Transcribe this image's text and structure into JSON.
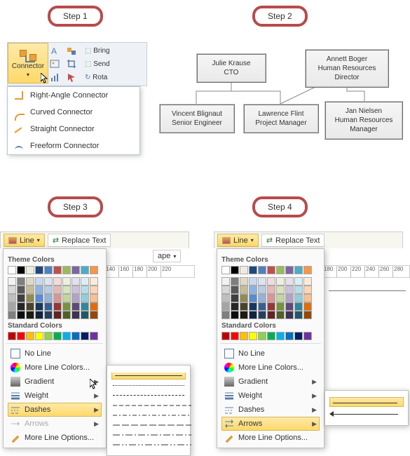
{
  "steps": {
    "s1": "Step 1",
    "s2": "Step 2",
    "s3": "Step 3",
    "s4": "Step 4"
  },
  "ribbon": {
    "connector_label": "Connector",
    "bring": "Bring",
    "send": "Send",
    "rotate": "Rota"
  },
  "connector_menu": {
    "right": "Right-Angle Connector",
    "curved": "Curved Connector",
    "straight": "Straight Connector",
    "freeform": "Freeform Connector"
  },
  "org": {
    "cto_name": "Julie Krause",
    "cto_title": "CTO",
    "hr_dir_name": "Annett Boger",
    "hr_dir_title": "Human Resources Director",
    "eng_name": "Vincent Blignaut",
    "eng_title": "Senior Engineer",
    "pm_name": "Lawrence Flint",
    "pm_title": "Project Manager",
    "hrm_name": "Jan Nielsen",
    "hrm_title": "Human Resources Manager"
  },
  "line_tab": "Line",
  "replace_tab": "Replace Text",
  "shape_tab": "ape",
  "section_theme": "Theme Colors",
  "section_standard": "Standard Colors",
  "line_menu": {
    "no_line": "No Line",
    "more_colors": "More Line Colors...",
    "gradient": "Gradient",
    "weight": "Weight",
    "dashes": "Dashes",
    "arrows": "Arrows",
    "more_options": "More Line Options..."
  },
  "theme_colors_row1": [
    "#ffffff",
    "#000000",
    "#eeece1",
    "#1f497d",
    "#4f81bd",
    "#c0504d",
    "#9bbb59",
    "#8064a2",
    "#4bacc6",
    "#f79646"
  ],
  "theme_colors_shades": [
    [
      "#f2f2f2",
      "#7f7f7f",
      "#ddd9c3",
      "#c6d9f0",
      "#dbe5f1",
      "#f2dcdb",
      "#ebf1dd",
      "#e5e0ec",
      "#dbeef3",
      "#fdeada"
    ],
    [
      "#d8d8d8",
      "#595959",
      "#c4bd97",
      "#8db3e2",
      "#b8cce4",
      "#e5b9b7",
      "#d7e3bc",
      "#ccc1d9",
      "#b7dde8",
      "#fbd5b5"
    ],
    [
      "#bfbfbf",
      "#3f3f3f",
      "#938953",
      "#548dd4",
      "#95b3d7",
      "#d99694",
      "#c3d69b",
      "#b2a2c7",
      "#92cddc",
      "#fac08f"
    ],
    [
      "#a5a5a5",
      "#262626",
      "#494429",
      "#17365d",
      "#366092",
      "#953734",
      "#76923c",
      "#5f497a",
      "#31859b",
      "#e36c09"
    ],
    [
      "#7f7f7f",
      "#0c0c0c",
      "#1d1b10",
      "#0f243e",
      "#244061",
      "#632423",
      "#4f6128",
      "#3f3151",
      "#205867",
      "#974806"
    ]
  ],
  "standard_colors": [
    "#c00000",
    "#ff0000",
    "#ffc000",
    "#ffff00",
    "#92d050",
    "#00b050",
    "#00b0f0",
    "#0070c0",
    "#002060",
    "#7030a0"
  ],
  "ruler_ticks3": [
    "140",
    "160",
    "180",
    "200",
    "220"
  ],
  "ruler_ticks4": [
    "180",
    "200",
    "220",
    "240",
    "260",
    "280"
  ],
  "dash_styles": [
    "solid",
    "dash4",
    "dash2",
    "dot",
    "dashdot",
    "dashdotdot",
    "longdash",
    "longdashdot"
  ]
}
